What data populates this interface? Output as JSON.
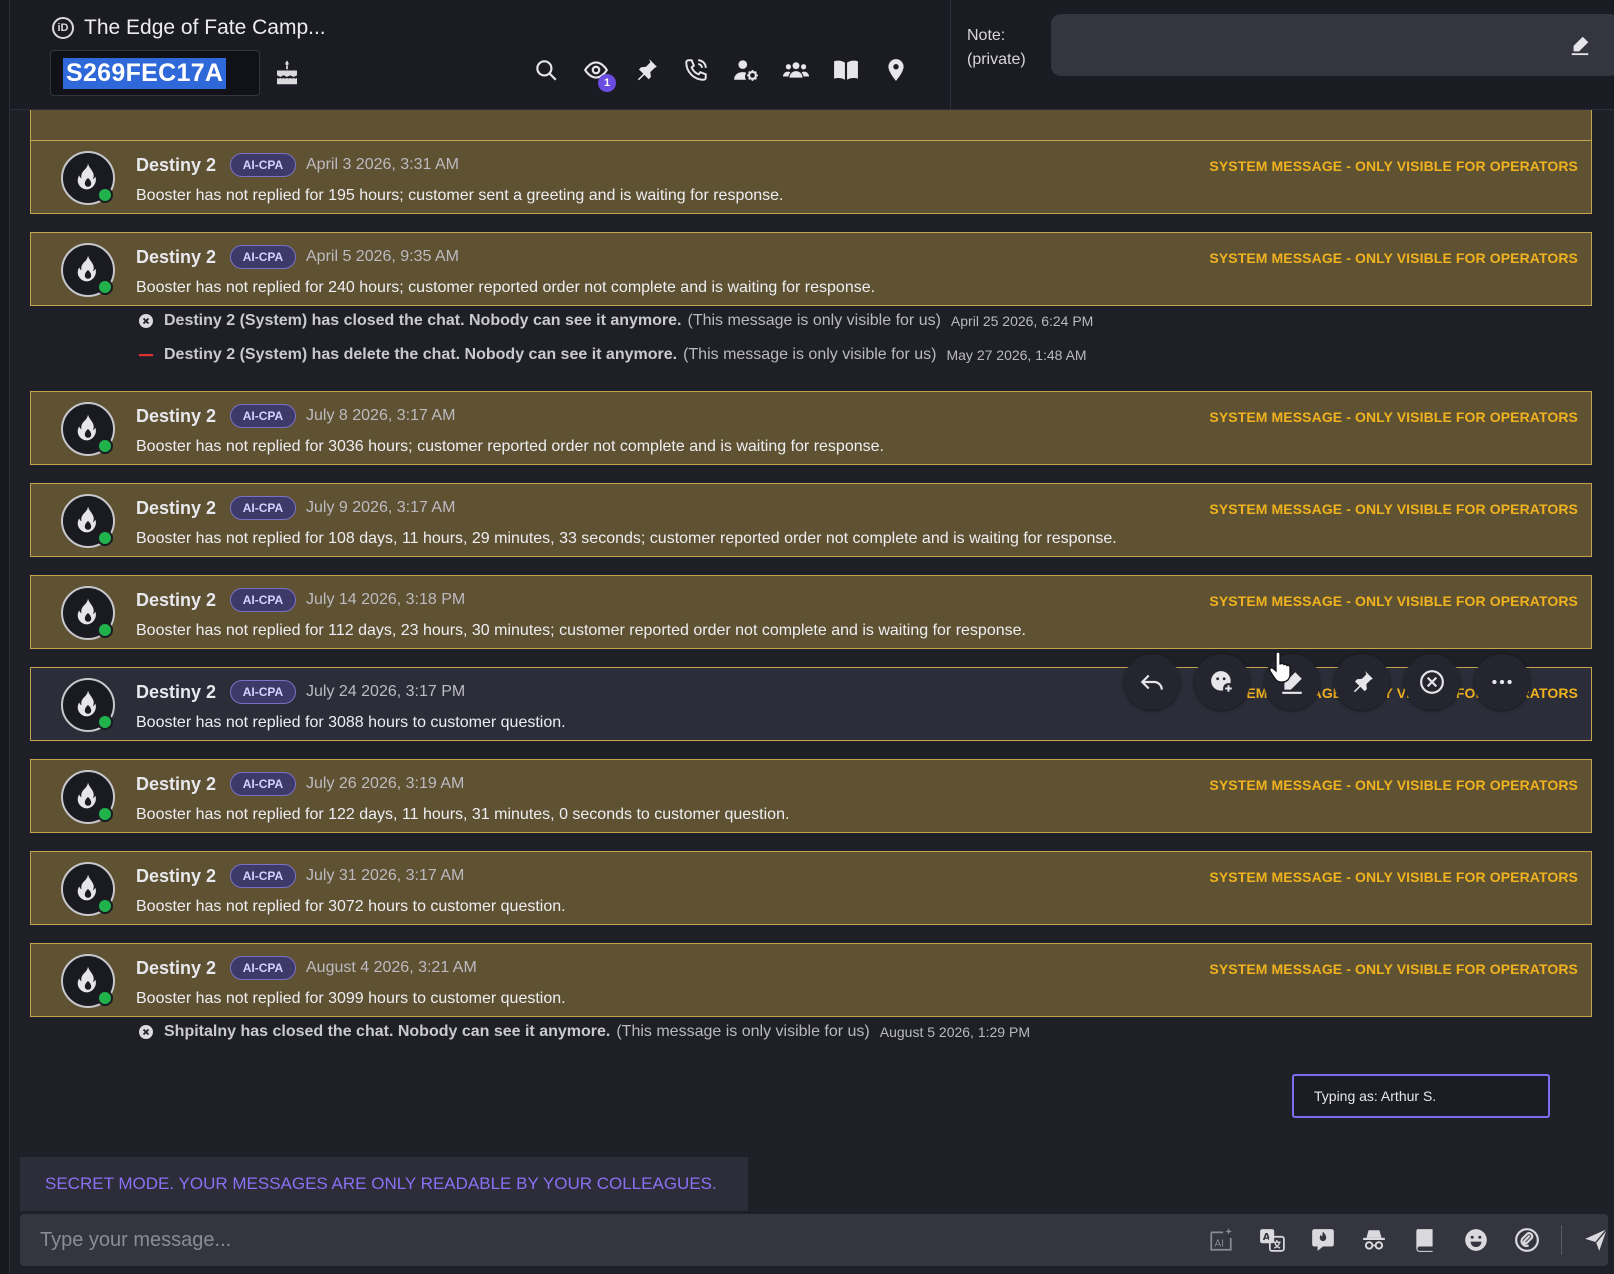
{
  "header": {
    "title": "The Edge of Fate Camp...",
    "order_id": "S269FEC17A",
    "watchers_count": "1",
    "note_label": "Note:\n(private)",
    "note_value": ""
  },
  "messages": [
    {
      "sender": "Destiny 2",
      "tag": "AI-CPA",
      "time": "April 3 2026, 3:31 AM",
      "text": "Booster has not replied for 195 hours; customer sent a greeting and is waiting for response.",
      "system_label": "SYSTEM MESSAGE - ONLY VISIBLE FOR OPERATORS"
    },
    {
      "sender": "Destiny 2",
      "tag": "AI-CPA",
      "time": "April 5 2026, 9:35 AM",
      "text": "Booster has not replied for 240 hours; customer reported order not complete and is waiting for response.",
      "system_label": "SYSTEM MESSAGE - ONLY VISIBLE FOR OPERATORS"
    },
    {
      "sender": "Destiny 2",
      "tag": "AI-CPA",
      "time": "July 8 2026, 3:17 AM",
      "text": "Booster has not replied for 3036 hours; customer reported order not complete and is waiting for response.",
      "system_label": "SYSTEM MESSAGE - ONLY VISIBLE FOR OPERATORS"
    },
    {
      "sender": "Destiny 2",
      "tag": "AI-CPA",
      "time": "July 9 2026, 3:17 AM",
      "text": "Booster has not replied for 108 days, 11 hours, 29 minutes, 33 seconds; customer reported order not complete and is waiting for response.",
      "system_label": "SYSTEM MESSAGE - ONLY VISIBLE FOR OPERATORS"
    },
    {
      "sender": "Destiny 2",
      "tag": "AI-CPA",
      "time": "July 14 2026, 3:18 PM",
      "text": "Booster has not replied for 112 days, 23 hours, 30 minutes; customer reported order not complete and is waiting for response.",
      "system_label": "SYSTEM MESSAGE - ONLY VISIBLE FOR OPERATORS"
    },
    {
      "sender": "Destiny 2",
      "tag": "AI-CPA",
      "time": "July 24 2026, 3:17 PM",
      "text": "Booster has not replied for 3088 hours to customer question.",
      "system_label": "SYSTEM MESSAGE - ONLY VISIBLE FOR OPERATORS"
    },
    {
      "sender": "Destiny 2",
      "tag": "AI-CPA",
      "time": "July 26 2026, 3:19 AM",
      "text": "Booster has not replied for 122 days, 11 hours, 31 minutes, 0 seconds to customer question.",
      "system_label": "SYSTEM MESSAGE - ONLY VISIBLE FOR OPERATORS"
    },
    {
      "sender": "Destiny 2",
      "tag": "AI-CPA",
      "time": "July 31 2026, 3:17 AM",
      "text": "Booster has not replied for 3072 hours to customer question.",
      "system_label": "SYSTEM MESSAGE - ONLY VISIBLE FOR OPERATORS"
    },
    {
      "sender": "Destiny 2",
      "tag": "AI-CPA",
      "time": "August 4 2026, 3:21 AM",
      "text": "Booster has not replied for 3099 hours to customer question.",
      "system_label": "SYSTEM MESSAGE - ONLY VISIBLE FOR OPERATORS"
    }
  ],
  "events": [
    {
      "strong": "Destiny 2 (System) has closed the chat. Nobody can see it anymore.",
      "note": "(This message is only visible for us)",
      "time": "April 25 2026, 6:24 PM",
      "icon": "close-circle-icon"
    },
    {
      "strong": "Destiny 2 (System) has delete the chat. Nobody can see it anymore.",
      "note": "(This message is only visible for us)",
      "time": "May 27 2026, 1:48 AM",
      "icon": "minus-icon"
    },
    {
      "strong": "Shpitalny has closed the chat. Nobody can see it anymore.",
      "note": "(This message is only visible for us)",
      "time": "August 5 2026, 1:29 PM",
      "icon": "close-circle-icon"
    }
  ],
  "typing_as": "Typing as: Arthur S.",
  "secret_banner": "SECRET MODE. YOUR MESSAGES ARE ONLY READABLE BY YOUR COLLEAGUES.",
  "composer": {
    "placeholder": "Type your message..."
  },
  "colors": {
    "system_bg": "#5e5233",
    "system_border": "#c2a54e",
    "system_label": "#f0b21e",
    "accent": "#8a70f4",
    "online": "#22b24c"
  }
}
